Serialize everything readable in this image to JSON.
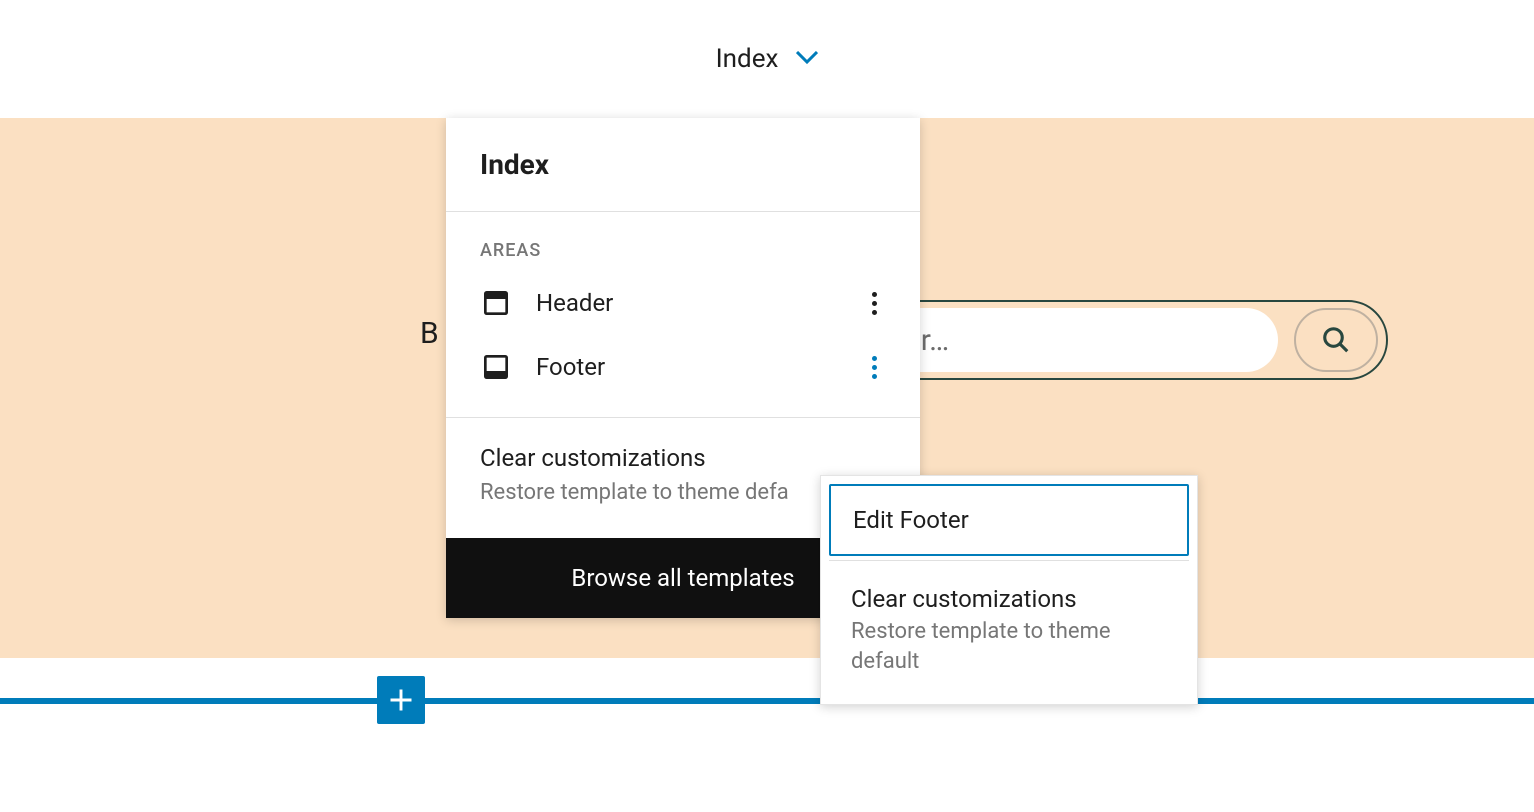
{
  "topbar": {
    "title": "Index"
  },
  "canvas": {
    "block_label_visible_fragment": "B",
    "search_placeholder_visible_fragment": "otional placeholder…"
  },
  "popover": {
    "title": "Index",
    "areas_label": "AREAS",
    "areas": [
      {
        "label": "Header",
        "active": false
      },
      {
        "label": "Footer",
        "active": true
      }
    ],
    "clear": {
      "title": "Clear customizations",
      "subtitle_visible_fragment": "Restore template to theme defa"
    },
    "browse_label": "Browse all templates"
  },
  "submenu": {
    "edit_label": "Edit Footer",
    "clear": {
      "title": "Clear customizations",
      "subtitle": "Restore template to theme default"
    }
  }
}
